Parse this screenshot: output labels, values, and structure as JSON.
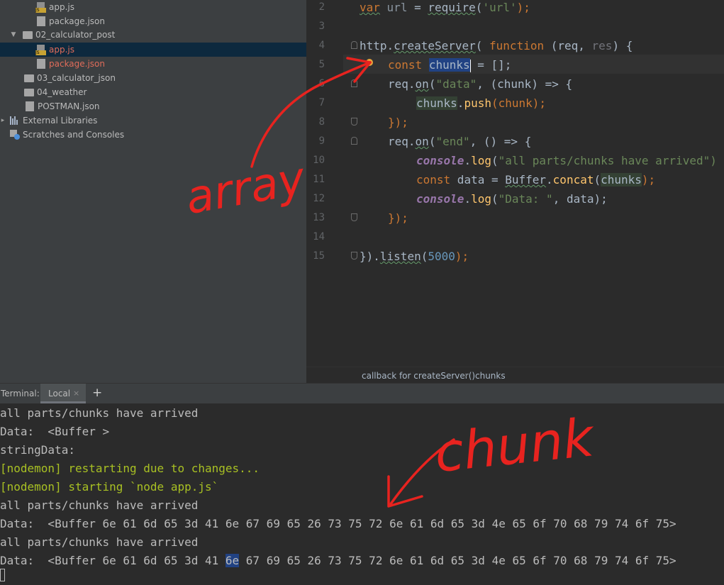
{
  "project_tree": {
    "items": [
      {
        "label": "app.js",
        "icon": "js-file-icon",
        "modified": false
      },
      {
        "label": "package.json",
        "icon": "json-file-icon",
        "modified": false
      },
      {
        "label": "02_calculator_post",
        "icon": "folder-icon",
        "expanded": true
      },
      {
        "label": "app.js",
        "icon": "js-file-icon",
        "modified": true,
        "selected": true
      },
      {
        "label": "package.json",
        "icon": "json-file-icon",
        "modified": true
      },
      {
        "label": "03_calculator_json",
        "icon": "folder-icon"
      },
      {
        "label": "04_weather",
        "icon": "folder-icon"
      },
      {
        "label": "POSTMAN.json",
        "icon": "json-file-icon"
      },
      {
        "label": "External Libraries",
        "icon": "library-icon"
      },
      {
        "label": "Scratches and Consoles",
        "icon": "scratches-icon"
      }
    ]
  },
  "editor": {
    "line_numbers": [
      "2",
      "3",
      "4",
      "5",
      "6",
      "7",
      "8",
      "9",
      "10",
      "11",
      "12",
      "13",
      "14",
      "15"
    ],
    "lines": {
      "l2": {
        "kw": "var",
        "name": "url",
        "eq": " = ",
        "fn": "require",
        "open": "(",
        "str": "'url'",
        "close": ");"
      },
      "l4": {
        "obj": "http",
        "dot": ".",
        "fn": "createServer",
        "open": "( ",
        "kw": "function",
        "params": " (req, ",
        "res": "res",
        "close": ") {"
      },
      "l5": {
        "kw": "const",
        "var": "chunks",
        "rest": " = [];"
      },
      "l6": {
        "obj": "req",
        "dot": ".",
        "fn": "on",
        "open": "(",
        "str": "\"data\"",
        "rest": ", (chunk) => {"
      },
      "l7": {
        "var": "chunks",
        "dot": ".",
        "fn": "push",
        "rest": "(chunk);"
      },
      "l8": {
        "text": "});"
      },
      "l9": {
        "obj": "req",
        "dot": ".",
        "fn": "on",
        "open": "(",
        "str": "\"end\"",
        "rest": ", () => {"
      },
      "l10": {
        "con": "console",
        "dot": ".",
        "fn": "log",
        "open": "(",
        "str": "\"all parts/chunks have arrived\")"
      },
      "l11": {
        "kw": "const",
        "name": " data = ",
        "cls": "Buffer",
        "dot": ".",
        "fn": "concat",
        "open": "(",
        "var": "chunks",
        "close": ");"
      },
      "l12": {
        "con": "console",
        "dot": ".",
        "fn": "log",
        "open": "(",
        "str": "\"Data: \"",
        "rest": ", data);"
      },
      "l13": {
        "text": "});"
      },
      "l15": {
        "pre": "}).",
        "fn": "listen",
        "open": "(",
        "num": "5000",
        "close": ");"
      }
    }
  },
  "breadcrumbs": {
    "first": "callback for createServer()",
    "sep": "›",
    "second": "chunks"
  },
  "terminal": {
    "label": "Terminal:",
    "tab": "Local",
    "close": "×",
    "add": "+",
    "lines": [
      "all parts/chunks have arrived",
      "Data:  <Buffer >",
      "stringData:",
      "[nodemon] restarting due to changes...",
      "[nodemon] starting `node app.js`",
      "all parts/chunks have arrived",
      "Data:  <Buffer 6e 61 6d 65 3d 41 6e 67 69 65 26 73 75 72 6e 61 6d 65 3d 4e 65 6f 70 68 79 74 6f 75>",
      "all parts/chunks have arrived"
    ],
    "last_line": {
      "pre": "Data:  <Buffer 6e 61 6d 65 3d 41 ",
      "hl": "6e",
      "post": " 67 69 65 26 73 75 72 6e 61 6d 65 3d 4e 65 6f 70 68 79 74 6f 75>"
    }
  },
  "annotations": {
    "array_label": "array",
    "chunk_label": "chunk",
    "color": "#e8231f"
  }
}
